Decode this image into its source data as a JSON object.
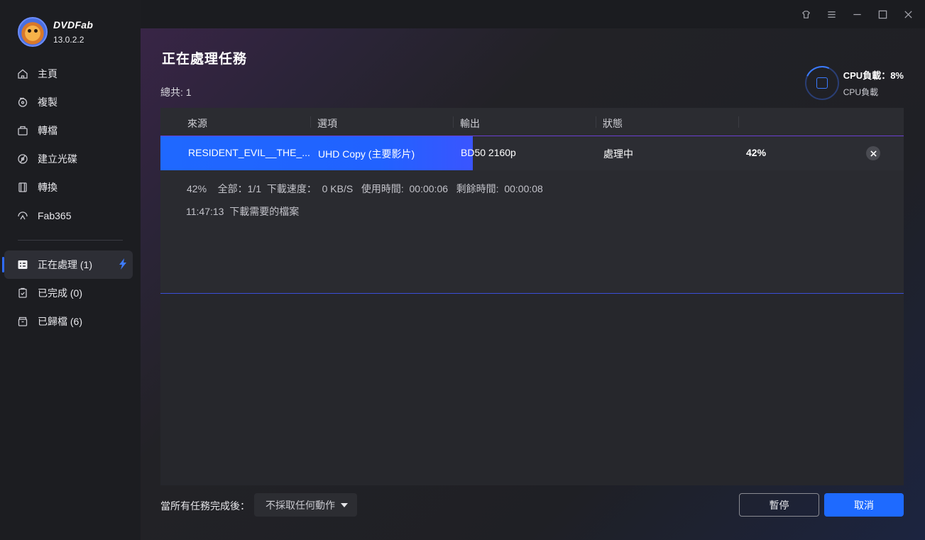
{
  "app": {
    "name": "DVDFab",
    "version": "13.0.2.2"
  },
  "sidebar": {
    "items": [
      {
        "label": "主頁",
        "icon": "home-icon"
      },
      {
        "label": "複製",
        "icon": "copy-disc-icon"
      },
      {
        "label": "轉檔",
        "icon": "convert-icon"
      },
      {
        "label": "建立光碟",
        "icon": "create-disc-icon"
      },
      {
        "label": "轉換",
        "icon": "film-icon"
      },
      {
        "label": "Fab365",
        "icon": "fab365-icon"
      }
    ],
    "queue": [
      {
        "label": "正在處理 (1)",
        "icon": "task-list-icon",
        "active": true
      },
      {
        "label": "已完成 (0)",
        "icon": "clipboard-check-icon"
      },
      {
        "label": "已歸檔 (6)",
        "icon": "archive-icon"
      }
    ]
  },
  "window": {
    "controls": [
      "skin-icon",
      "menu-icon",
      "minimize-icon",
      "maximize-icon",
      "close-icon"
    ]
  },
  "page": {
    "title": "正在處理任務",
    "total": "總共: 1"
  },
  "cpu": {
    "title": "CPU負載：8%",
    "subtitle": "CPU負載",
    "load_percent": 8
  },
  "table": {
    "headers": [
      "來源",
      "選項",
      "輸出",
      "狀態"
    ],
    "rows": [
      {
        "source": "RESIDENT_EVIL__THE_...",
        "option": "UHD Copy (主要影片)",
        "output": "BD50 2160p",
        "status": "處理中",
        "percent": "42%",
        "progress": 0.42
      }
    ]
  },
  "detail": {
    "line1": "42%    全部：1/1  下載速度：  0 KB/S   使用時間:  00:00:06   剩餘時間:  00:00:08",
    "line2": "11:47:13  下載需要的檔案"
  },
  "footer": {
    "after_label": "當所有任務完成後：",
    "after_value": "不採取任何動作",
    "pause_label": "暫停",
    "cancel_label": "取消"
  },
  "colors": {
    "accent": "#1e6aff",
    "sidebar_bg": "#1c1d21",
    "panel_bg": "#26272c"
  }
}
